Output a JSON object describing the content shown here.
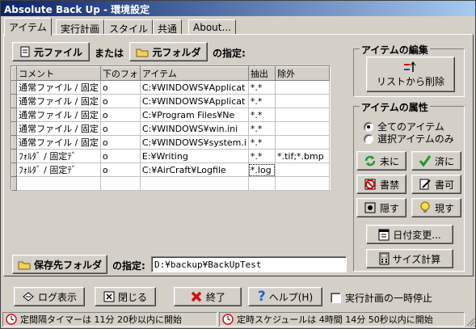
{
  "window": {
    "title": "Absolute Back Up - 環境設定"
  },
  "tabs": [
    {
      "label": "アイテム",
      "active": true
    },
    {
      "label": "実行計画",
      "active": false
    },
    {
      "label": "スタイル",
      "active": false
    },
    {
      "label": "共通",
      "active": false
    },
    {
      "label": "About...",
      "active": false
    }
  ],
  "source": {
    "file_button": "元ファイル",
    "or_text": "または",
    "folder_button": "元フォルダ",
    "spec_text": "の指定:"
  },
  "grid": {
    "columns": [
      "コメント",
      "下のフォ",
      "アイテム",
      "抽出",
      "除外"
    ],
    "rows": [
      [
        "通常ファイル / 固定",
        "o",
        "C:¥WINDOWS¥Applicat",
        "*.*",
        ""
      ],
      [
        "通常ファイル / 固定",
        "o",
        "C:¥WINDOWS¥Applicat",
        "*.*",
        ""
      ],
      [
        "通常ファイル / 固定",
        "o",
        "C:¥Program Files¥Ne",
        "*.*",
        ""
      ],
      [
        "通常ファイル / 固定",
        "o",
        "C:¥WINDOWS¥win.ini",
        "*.*",
        ""
      ],
      [
        "通常ファイル / 固定",
        "o",
        "C:¥WINDOWS¥system.i",
        "*.*",
        ""
      ],
      [
        "ﾌｫﾙﾀﾞ / 固定ﾃﾞ",
        "o",
        "E:¥Writing",
        "*.*",
        "*.tif;*.bmp"
      ],
      [
        "ﾌｫﾙﾀﾞ / 固定ﾃﾞ",
        "o",
        "C:¥AirCraft¥Logfile",
        "*.log",
        ""
      ],
      [
        "",
        "",
        "",
        "",
        ""
      ]
    ]
  },
  "edit_group": {
    "title": "アイテムの編集",
    "delete_button": "リストから削除"
  },
  "attr_group": {
    "title": "アイテムの属性",
    "radio_all": "全てのアイテム",
    "radio_selected": "選択アイテムのみ",
    "buttons": {
      "undone": "未に",
      "done": "済に",
      "write_forbid": "書禁",
      "write_allow": "書可",
      "hide": "隠す",
      "show": "現す",
      "date_change": "日付変更...",
      "size_calc": "サイズ計算"
    }
  },
  "dest": {
    "folder_button": "保存先フォルダ",
    "spec_label": "の指定:",
    "path_value": "D:¥backup¥BackUpTest"
  },
  "footer": {
    "log_button": "ログ表示",
    "close_button": "閉じる",
    "exit_button": "終了",
    "help_button": "ヘルプ(H)",
    "pause_checkbox": "実行計画の一時停止"
  },
  "statusbar": {
    "left": "定間隔タイマーは 11分 20秒以内に開始",
    "right": "定時スケジュールは 4時間 14分 50秒以内に開始"
  },
  "colors": {
    "titlebar_start": "#0a246a",
    "titlebar_end": "#a6caf0",
    "face": "#d4d0c8",
    "accent_green": "#1a9a2a",
    "accent_red": "#d01010"
  }
}
